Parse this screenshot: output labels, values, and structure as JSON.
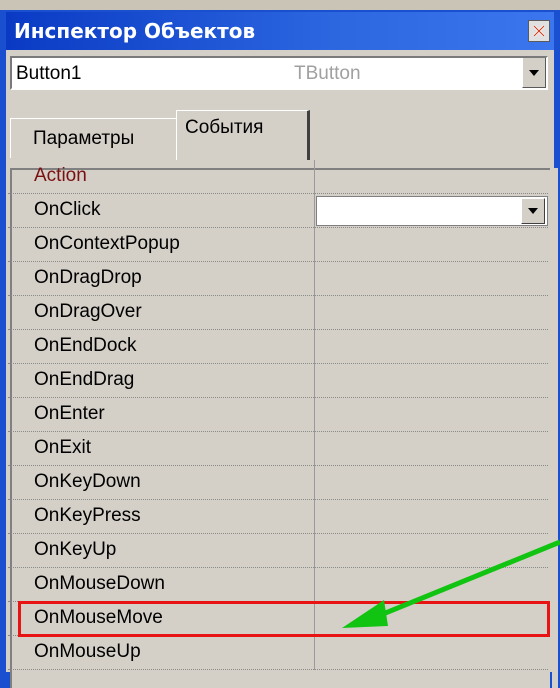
{
  "window": {
    "title": "Инспектор Объектов"
  },
  "object_selector": {
    "name": "Button1",
    "type": "TButton"
  },
  "tabs": [
    {
      "label": "Параметры",
      "active": false
    },
    {
      "label": "События",
      "active": true
    }
  ],
  "events": {
    "category": "Action",
    "rows": [
      "OnClick",
      "OnContextPopup",
      "OnDragDrop",
      "OnDragOver",
      "OnEndDock",
      "OnEndDrag",
      "OnEnter",
      "OnExit",
      "OnKeyDown",
      "OnKeyPress",
      "OnKeyUp",
      "OnMouseDown",
      "OnMouseMove",
      "OnMouseUp"
    ]
  },
  "annotation": {
    "highlighted_row": "OnMouseMove",
    "highlight_color": "#e81414",
    "arrow_color": "#12c412"
  },
  "icons": {
    "close": "close-icon",
    "dropdown": "chevron-down-icon"
  }
}
